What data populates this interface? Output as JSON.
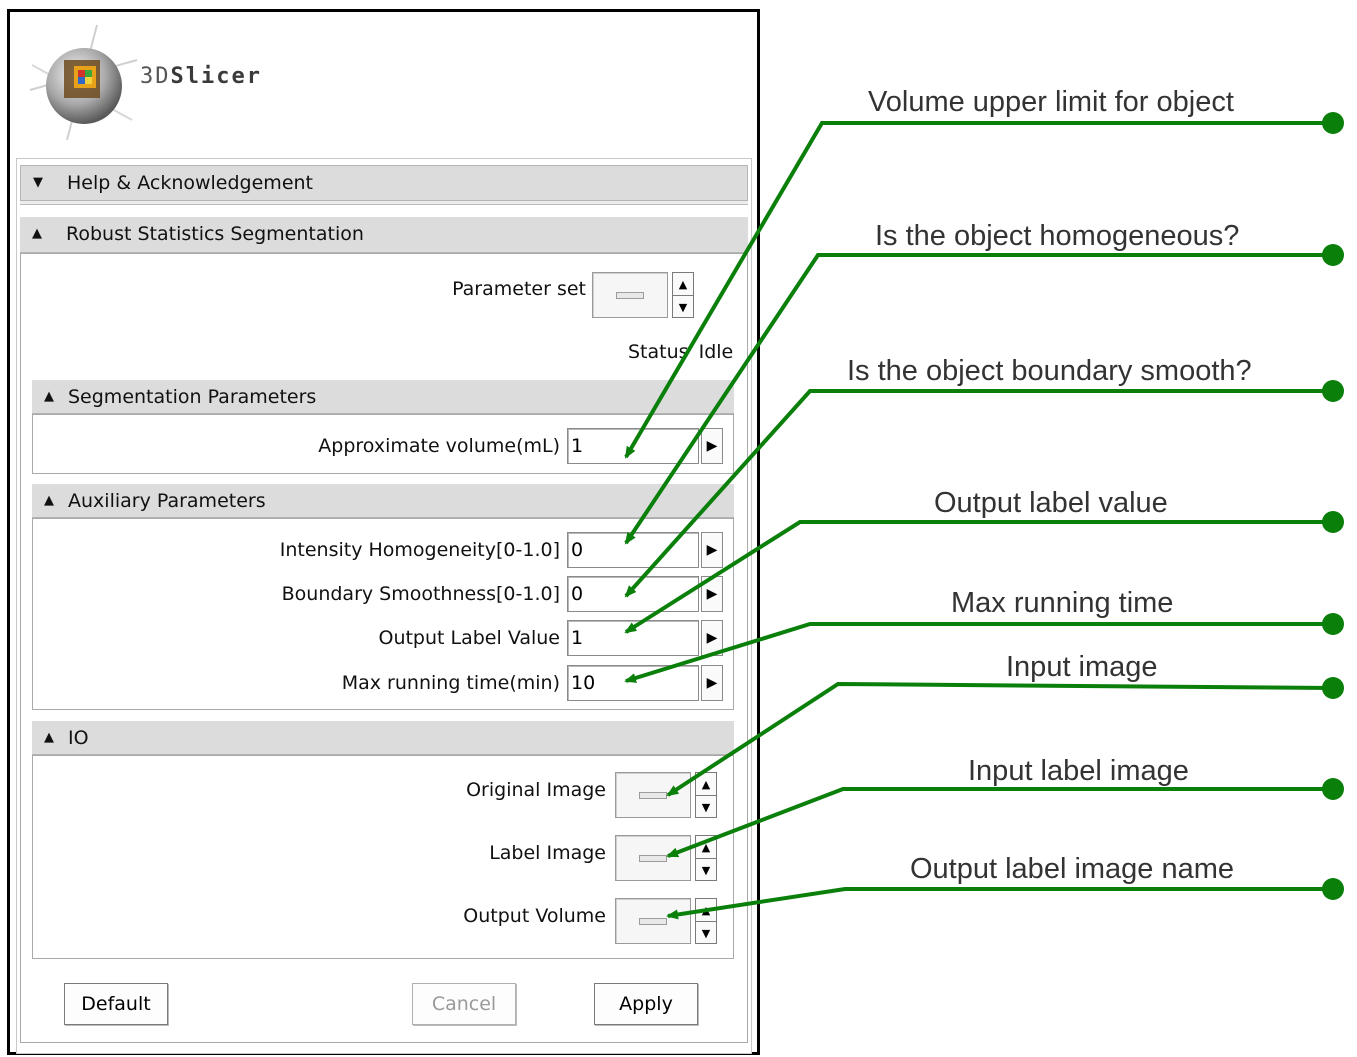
{
  "app": {
    "logo_text_prefix": "3D",
    "logo_text_suffix": "Slicer"
  },
  "sections": {
    "help": {
      "title": "Help & Acknowledgement"
    },
    "module": {
      "title": "Robust Statistics Segmentation"
    },
    "segmentation": {
      "title": "Segmentation Parameters"
    },
    "auxiliary": {
      "title": "Auxiliary Parameters"
    },
    "io": {
      "title": "IO"
    }
  },
  "parameter_set": {
    "label": "Parameter set"
  },
  "status": {
    "label": "Status",
    "value": "Idle"
  },
  "fields": {
    "approx_volume": {
      "label": "Approximate volume(mL)",
      "value": "1"
    },
    "intensity_homogeneity": {
      "label": "Intensity Homogeneity[0-1.0]",
      "value": "0"
    },
    "boundary_smoothness": {
      "label": "Boundary Smoothness[0-1.0]",
      "value": "0"
    },
    "output_label_value": {
      "label": "Output Label Value",
      "value": "1"
    },
    "max_running_time": {
      "label": "Max running time(min)",
      "value": "10"
    }
  },
  "io": {
    "original_image": {
      "label": "Original Image"
    },
    "label_image": {
      "label": "Label Image"
    },
    "output_volume": {
      "label": "Output Volume"
    }
  },
  "buttons": {
    "default": "Default",
    "cancel": "Cancel",
    "apply": "Apply"
  },
  "annotations": [
    "Volume upper limit for object",
    "Is the object homogeneous?",
    "Is the object boundary smooth?",
    "Output label value",
    "Max running time",
    "Input image",
    "Input label image",
    "Output label image name"
  ],
  "colors": {
    "annotation_line": "#0a7f0a",
    "header_bg": "#dcdcdc"
  },
  "icons": {
    "expanded": "triangle-up-icon",
    "collapsed": "triangle-down-icon",
    "spin_right": "triangle-right-icon"
  }
}
